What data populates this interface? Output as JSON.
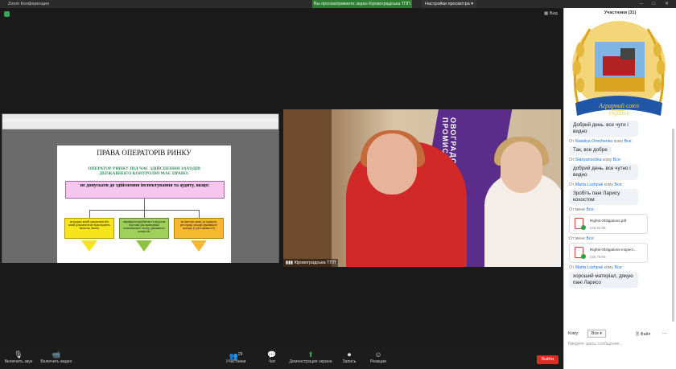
{
  "titlebar": {
    "app_title": "Zoom Конференция"
  },
  "share": {
    "status": "Вы просматриваете экран Кіровоградська ТПП",
    "view_options": "Настройки просмотра"
  },
  "view_label": "Вид",
  "shared_doc": {
    "title": "ПРАВА ОПЕРАТОРІВ РИНКУ",
    "subtitle": "ОПЕРАТОР РИНКУ ПІД ЧАС ЗДІЙСНЕННЯ ЗАХОДІВ ДЕРЖАВНОГО КОНТРОЛЮ МАЄ ПРАВО:",
    "main_box": "не допускати до здійснення інспектування та аудиту, якщо:",
    "boxes": [
      "не надано копій документів або копій документів не відповідають вимогам Закону",
      "перевірка передбачена та відсутня підстава для проведення позапланового заходу державного контролю",
      "не внесено запис до журналу реєстрації заходів державного нагляду (у разі наявності)"
    ]
  },
  "video": {
    "name": "Кіровоградська ТПП",
    "banner_text": "ОВОГРАДСЬКА ТОРГОВО-ПРОМИСЛОВ"
  },
  "panel": {
    "header": "Участники (31)",
    "logo_text": {
      "line1": "Аграрний союз",
      "line2": "України"
    },
    "messages": [
      {
        "type": "text",
        "from": "",
        "text": "Добрий день. все чути і видно"
      },
      {
        "type": "text",
        "from": "Nataliya Omichenko",
        "to": "Все",
        "text": "Так, все добре"
      },
      {
        "type": "text",
        "from": "Slanyanochka",
        "to": "Все",
        "text": "добрий день, все чутно і видно"
      },
      {
        "type": "text",
        "from": "Marta Lushpak",
        "to": "Все",
        "text": "Зробіть пані Ларису кохостом"
      },
      {
        "type": "file",
        "from": "мене",
        "to": "Все",
        "filename": "Rights-Obligations.pdf",
        "size": "249.92 КБ"
      },
      {
        "type": "file",
        "from": "мене",
        "to": "Все",
        "filename": "Rights-Obligations-Inspect...",
        "size": "230.76 КБ"
      },
      {
        "type": "text",
        "from": "Marta Lushpak",
        "to": "Все",
        "text": "хороший матеріал, дякую пані Ларисо"
      }
    ],
    "to_label": "Кому:",
    "to_value": "Все",
    "file_button": "Файл",
    "more": "...",
    "input_placeholder": "Введите здесь сообщение..."
  },
  "bottombar": {
    "items": [
      {
        "icon": "mic-off-icon",
        "label": "Включить звук"
      },
      {
        "icon": "video-off-icon",
        "label": "Включить видео"
      },
      {
        "icon": "participants-icon",
        "label": "Участники",
        "count": "29"
      },
      {
        "icon": "chat-icon",
        "label": "Чат"
      },
      {
        "icon": "share-screen-icon",
        "label": "Демонстрация экрана"
      },
      {
        "icon": "record-icon",
        "label": "Запись"
      },
      {
        "icon": "reactions-icon",
        "label": "Реакции"
      }
    ],
    "leave": "Выйти"
  },
  "colors": {
    "share_green": "#2e7d32",
    "leave_red": "#d93025",
    "banner_purple": "#5a2d8a",
    "link_blue": "#1a73e8"
  }
}
